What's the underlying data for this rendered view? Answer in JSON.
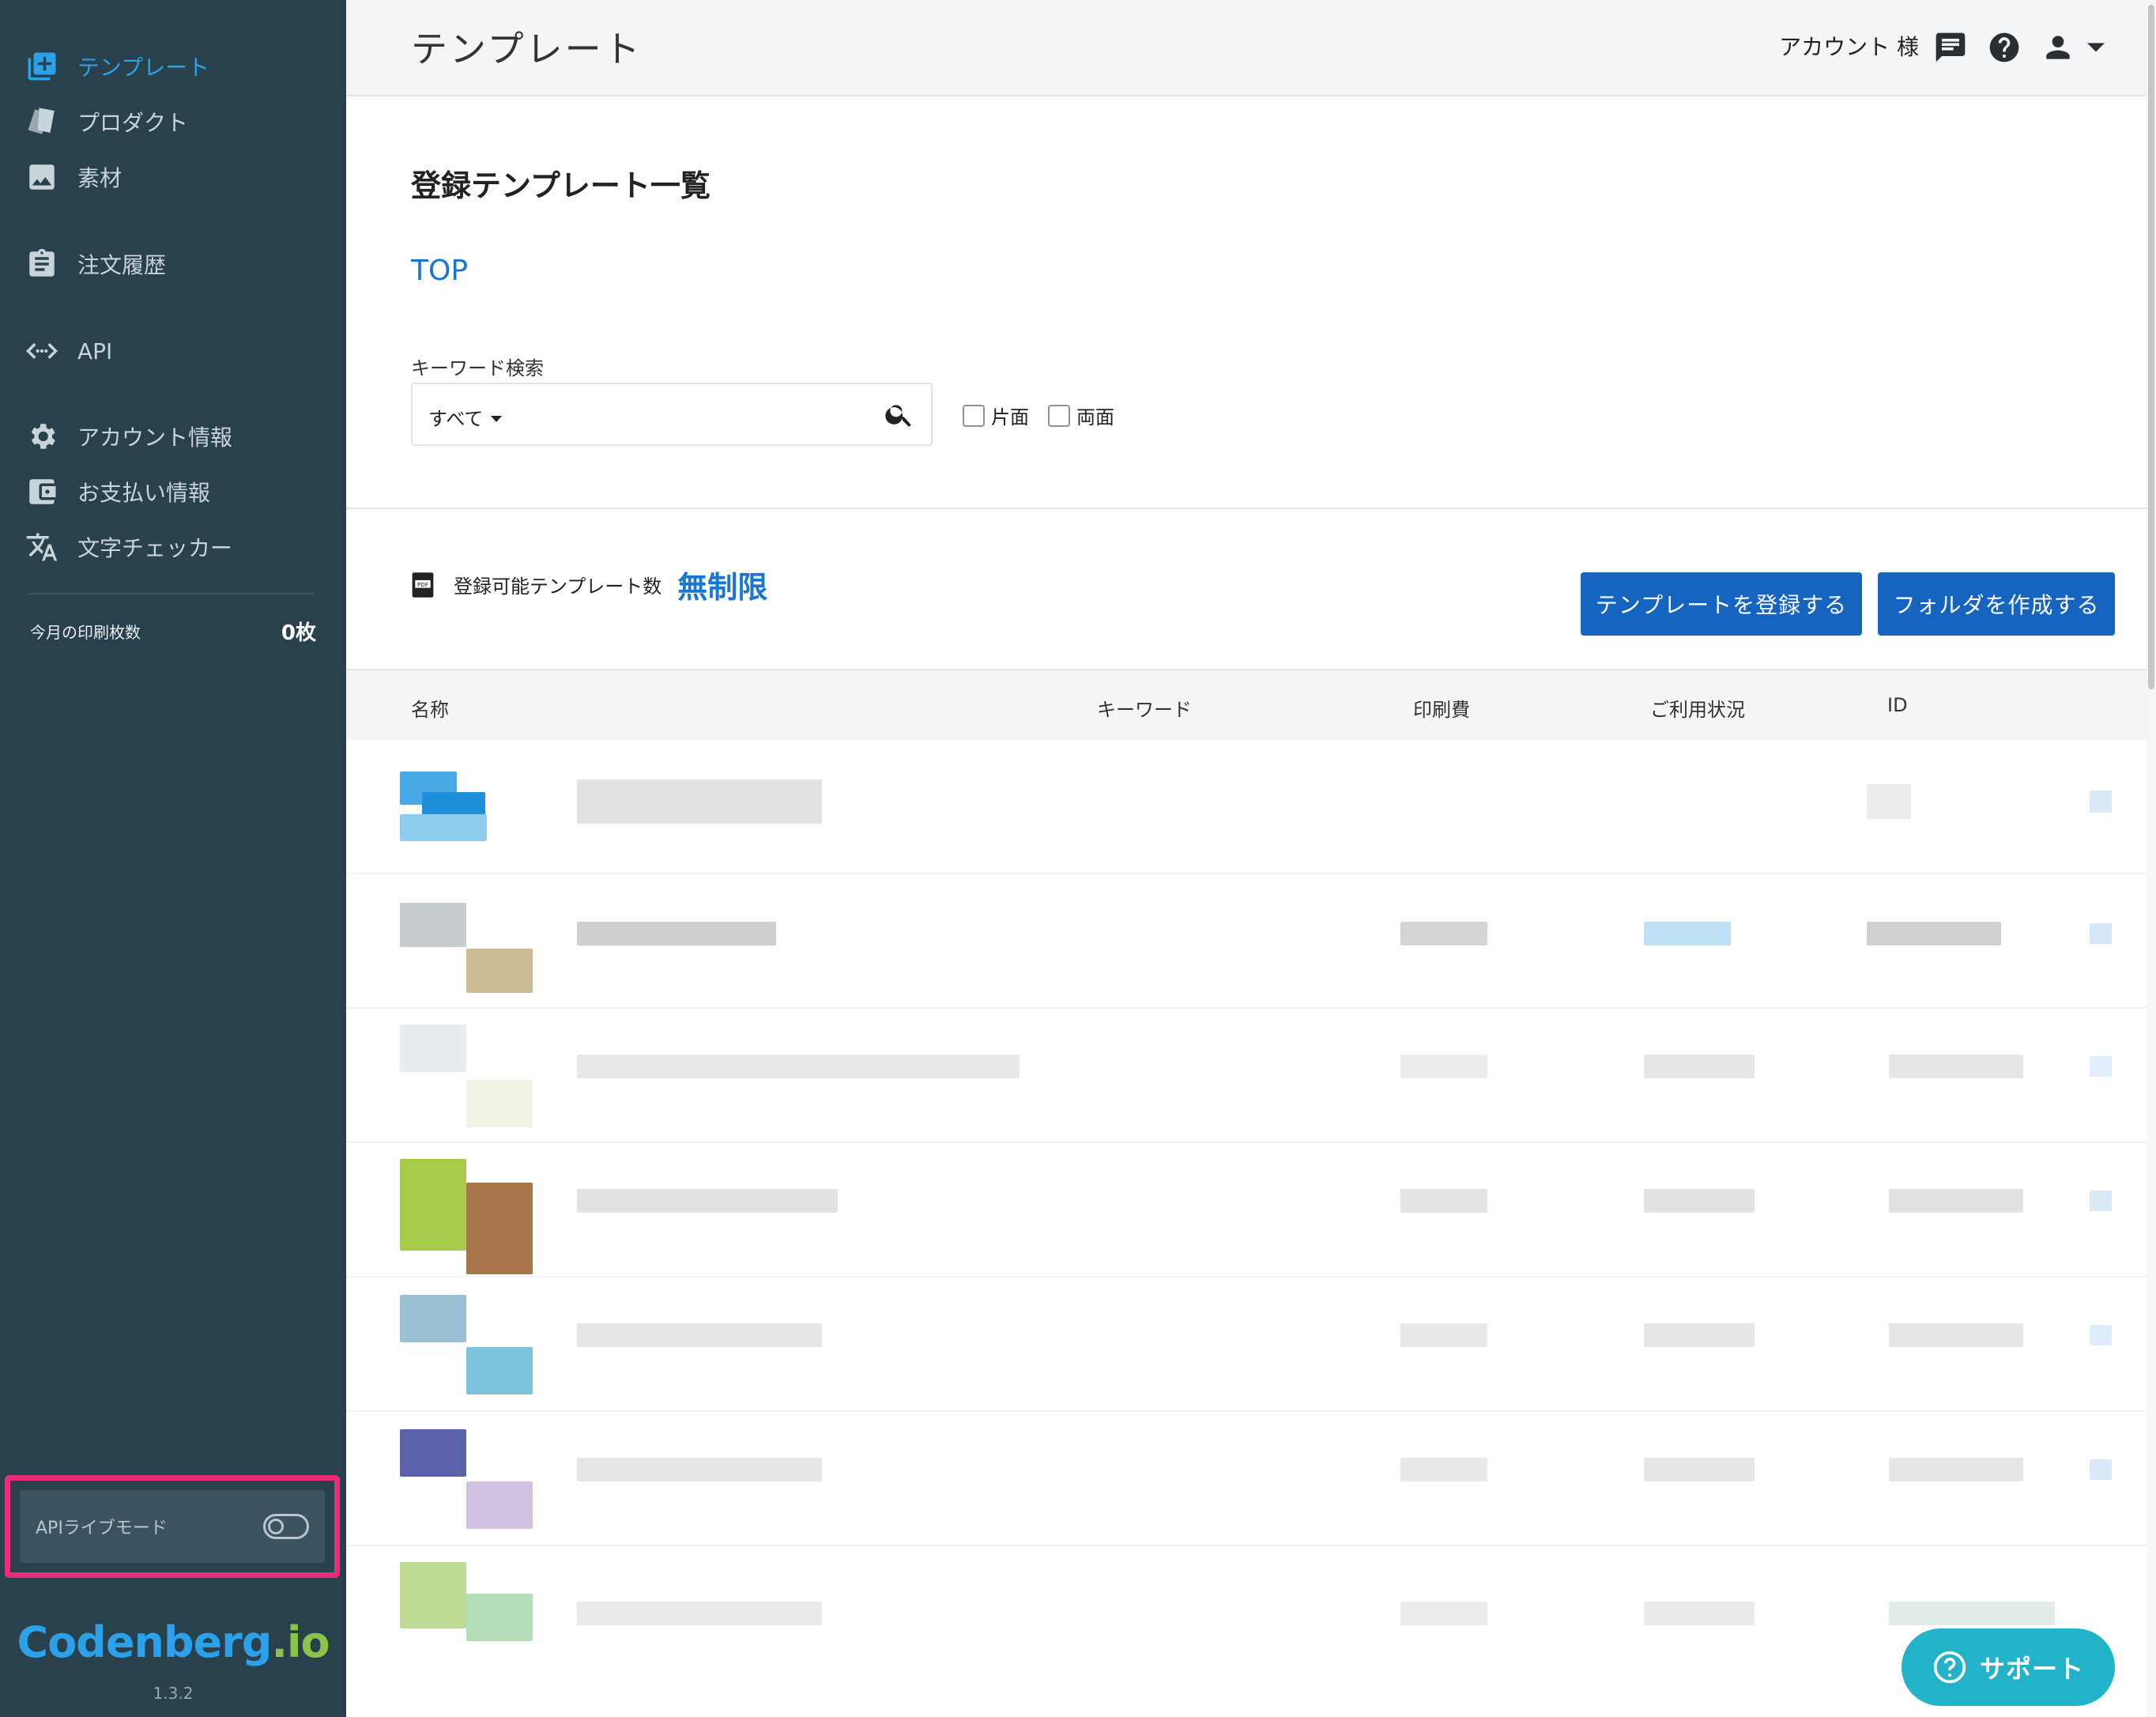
{
  "sidebar": {
    "items": [
      {
        "label": "テンプレート",
        "icon": "template-add-icon",
        "active": true
      },
      {
        "label": "プロダクト",
        "icon": "product-cards-icon"
      },
      {
        "label": "素材",
        "icon": "image-icon"
      },
      {
        "label": "注文履歴",
        "icon": "clipboard-icon"
      },
      {
        "label": "API",
        "icon": "code-icon"
      },
      {
        "label": "アカウント情報",
        "icon": "gear-icon"
      },
      {
        "label": "お支払い情報",
        "icon": "wallet-icon"
      },
      {
        "label": "文字チェッカー",
        "icon": "translate-icon"
      }
    ],
    "print_count_label": "今月の印刷枚数",
    "print_count_value": "0枚",
    "live_mode_label": "APIライブモード",
    "live_mode_on": false,
    "logo_main": "Codenberg",
    "logo_dot": ".",
    "logo_tld": "io",
    "version": "1.3.2"
  },
  "topbar": {
    "title": "テンプレート",
    "account": "アカウント 様",
    "icons": [
      "chat-icon",
      "help-icon",
      "user-icon",
      "dropdown-caret-icon"
    ]
  },
  "main": {
    "heading": "登録テンプレート一覧",
    "breadcrumb": "TOP",
    "keyword_label": "キーワード検索",
    "search_scope": "すべて",
    "search_value": "",
    "checkbox_single": "片面",
    "checkbox_double": "両面",
    "quota_label": "登録可能テンプレート数",
    "quota_value": "無制限",
    "btn_register": "テンプレートを登録する",
    "btn_folder": "フォルダを作成する",
    "columns": [
      "名称",
      "キーワード",
      "印刷費",
      "ご利用状況",
      "ID"
    ]
  },
  "support_label": "サポート",
  "colors": {
    "sidebar_bg": "#29404d",
    "accent": "#2aa1e8",
    "primary_button": "#1565c0",
    "live_mode_highlight": "#ea2d78",
    "support_button": "#22b3c9"
  }
}
